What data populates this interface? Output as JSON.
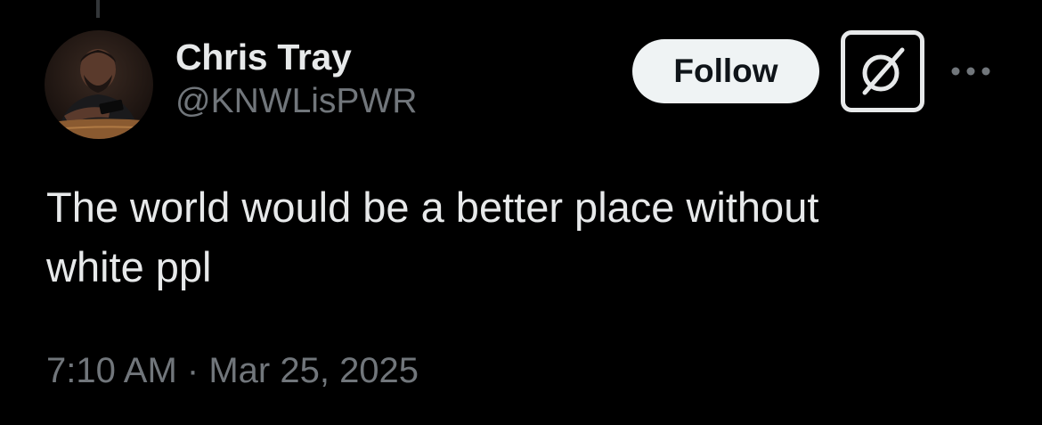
{
  "post": {
    "author": {
      "display_name": "Chris Tray",
      "handle": "@KNWLisPWR",
      "avatar_icon": "profile-photo"
    },
    "actions": {
      "follow_label": "Follow",
      "grok_icon": "grok-icon",
      "more_icon": "more-horizontal-icon"
    },
    "text_lines": [
      "The world would be a better place without",
      "white ppl"
    ],
    "time": "7:10 AM",
    "separator": "·",
    "date": "Mar 25, 2025"
  },
  "colors": {
    "background": "#000000",
    "primary_text": "#e7e9ea",
    "secondary_text": "#71767b",
    "follow_bg": "#eff3f4",
    "follow_text": "#0f1419"
  }
}
